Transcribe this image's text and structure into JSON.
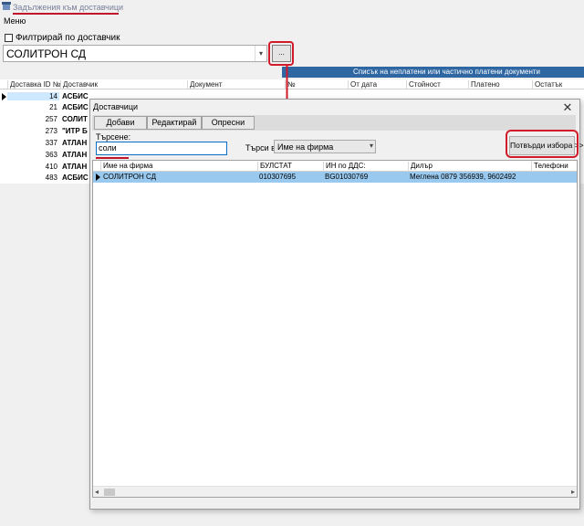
{
  "window": {
    "title": "Задължения към доставчици",
    "menu": "Меню"
  },
  "filter": {
    "checkbox_label": "Филтрирай по доставчик",
    "supplier_value": "СОЛИТРОН СД",
    "browse_label": "..."
  },
  "documents_bar": "Списък на неплатени или частично платени документи",
  "bg_grid": {
    "headers": [
      "Доставка ID №",
      "Доставчик",
      "Документ",
      "№",
      "От дата",
      "Стойност",
      "Платено",
      "Остатък"
    ],
    "rows": [
      {
        "id": "14",
        "name": "АСБИС"
      },
      {
        "id": "21",
        "name": "АСБИС"
      },
      {
        "id": "257",
        "name": "СОЛИТ"
      },
      {
        "id": "273",
        "name": "\"ИТР Б"
      },
      {
        "id": "337",
        "name": "АТЛАН"
      },
      {
        "id": "363",
        "name": "АТЛАН"
      },
      {
        "id": "410",
        "name": "АТЛАН"
      },
      {
        "id": "483",
        "name": "АСБИС"
      }
    ]
  },
  "dialog": {
    "title": "Доставчици",
    "close": "✕",
    "buttons": {
      "add": "Добави",
      "edit": "Редактирай",
      "refresh": "Опресни"
    },
    "search_label": "Търсене:",
    "search_value": "соли",
    "search_in_label": "Търси в:",
    "search_in_value": "Име на фирма",
    "confirm": "Потвърди избора >>",
    "grid": {
      "headers": [
        "Име на фирма",
        "БУЛСТАТ",
        "ИН по ДДС:",
        "Дилър",
        "Телефони"
      ],
      "rows": [
        {
          "name": "СОЛИТРОН СД",
          "bulstat": "010307695",
          "vat": "BG01030769",
          "dealer": "Меглена 0879 356939, 9602492",
          "phones": ""
        }
      ]
    }
  },
  "colors": {
    "accent_blue": "#2f67a3",
    "highlight_red": "#d21a2a",
    "selection": "#99c9ef"
  }
}
